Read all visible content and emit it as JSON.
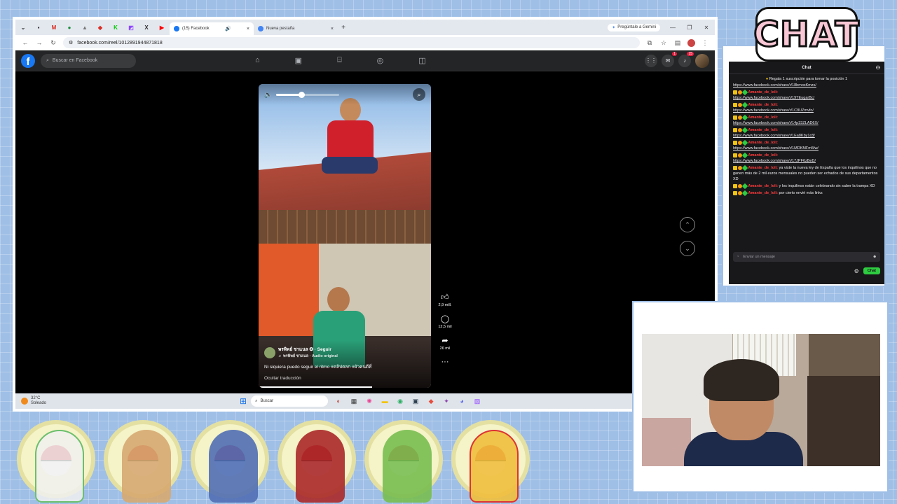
{
  "browser": {
    "tabs": [
      {
        "label": "(15) Facebook",
        "active": true
      },
      {
        "label": "Nueva pestaña",
        "active": false
      }
    ],
    "gemini_label": "Pregúntale a Gemini",
    "url": "facebook.com/reel/1012891944871818"
  },
  "facebook": {
    "logo": "f",
    "search_placeholder": "Buscar en Facebook",
    "notif_count": "15",
    "messenger_count": "1"
  },
  "reel": {
    "volume_level": 0.4,
    "author": "พรพิพย์ ชาแนล ✪ · Seguir",
    "audio": "♬ พรพิพย์ ชาแนล · Audio original",
    "caption": "Ni siquiera puedo seguir el ritmo #คลิปตลก #ผัวคนดีที่",
    "translate": "Ocultar traducción",
    "likes": "2,9 mill.",
    "comments": "12,5 mil",
    "shares": "26 mil",
    "progress": 0.66
  },
  "taskbar": {
    "temp": "32°C",
    "weather": "Soleado",
    "search": "Buscar"
  },
  "chat": {
    "logo": "CHAT",
    "title": "Chat",
    "pinned": "Regala 1 suscripción para tomar la posición 1",
    "first_link": "https://www.facebook.com/share/r/18bmosKmzs/",
    "messages": [
      {
        "user": "Amante_de_loli:",
        "text": "https://www.facebook.com/share/r/19TEugarBc/",
        "link": true
      },
      {
        "user": "Amante_de_loli:",
        "text": "https://www.facebook.com/share/r/1C8UZmvfo/",
        "link": true
      },
      {
        "user": "Amante_de_loli:",
        "text": "https://www.facebook.com/share/r/14p33ZLAD6X/",
        "link": true
      },
      {
        "user": "Amante_de_loli:",
        "text": "https://www.facebook.com/share/r/1Ea8Kby1c8/",
        "link": true
      },
      {
        "user": "Amante_de_loli:",
        "text": "https://www.facebook.com/share/r/1MDKMFm5fw/",
        "link": true
      },
      {
        "user": "Amante_de_loli:",
        "text": "https://www.facebook.com/share/r/17JPF6zBeD/",
        "link": true
      },
      {
        "user": "Amante_de_loli:",
        "text": "ya viste la nueva ley de España que los inquilinos que no ganen más de 2 mil euros mensuales no pueden ser echados de sus departamentos XD",
        "link": false
      },
      {
        "user": "Amante_de_loli:",
        "text": "y los inquilinos están celebrando sin saber la trampa XD",
        "link": false
      },
      {
        "user": "Amante_de_loli:",
        "text": "por cierto envié más links",
        "link": false
      }
    ],
    "input_placeholder": "Enviar un mensaje",
    "send_label": "Chat"
  },
  "colors": {
    "fb_blue": "#1877f2",
    "chat_user": "#ff3c3c",
    "chat_send": "#2ecc40",
    "background": "#9fbfe6"
  }
}
